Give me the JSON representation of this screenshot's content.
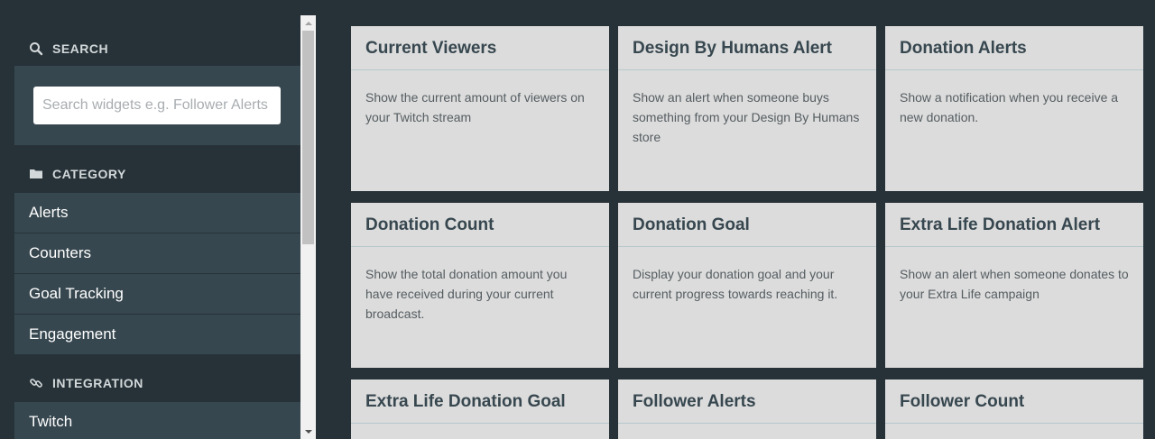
{
  "sidebar": {
    "search": {
      "header": "SEARCH",
      "placeholder": "Search widgets e.g. Follower Alerts",
      "value": ""
    },
    "category": {
      "header": "CATEGORY",
      "items": [
        {
          "label": "Alerts"
        },
        {
          "label": "Counters"
        },
        {
          "label": "Goal Tracking"
        },
        {
          "label": "Engagement"
        }
      ]
    },
    "integration": {
      "header": "INTEGRATION",
      "items": [
        {
          "label": "Twitch"
        }
      ]
    }
  },
  "widgets": [
    {
      "title": "Current Viewers",
      "description": "Show the current amount of viewers on your Twitch stream"
    },
    {
      "title": "Design By Humans Alert",
      "description": "Show an alert when someone buys something from your Design By Humans store"
    },
    {
      "title": "Donation Alerts",
      "description": "Show a notification when you receive a new donation."
    },
    {
      "title": "Donation Count",
      "description": "Show the total donation amount you have received during your current broadcast."
    },
    {
      "title": "Donation Goal",
      "description": "Display your donation goal and your current progress towards reaching it."
    },
    {
      "title": "Extra Life Donation Alert",
      "description": "Show an alert when someone donates to your Extra Life campaign"
    },
    {
      "title": "Extra Life Donation Goal",
      "description": ""
    },
    {
      "title": "Follower Alerts",
      "description": ""
    },
    {
      "title": "Follower Count",
      "description": ""
    }
  ],
  "colors": {
    "background": "#263238",
    "sidebar_item": "#37474f",
    "card": "#dcdcdc",
    "card_title": "#37474f"
  }
}
